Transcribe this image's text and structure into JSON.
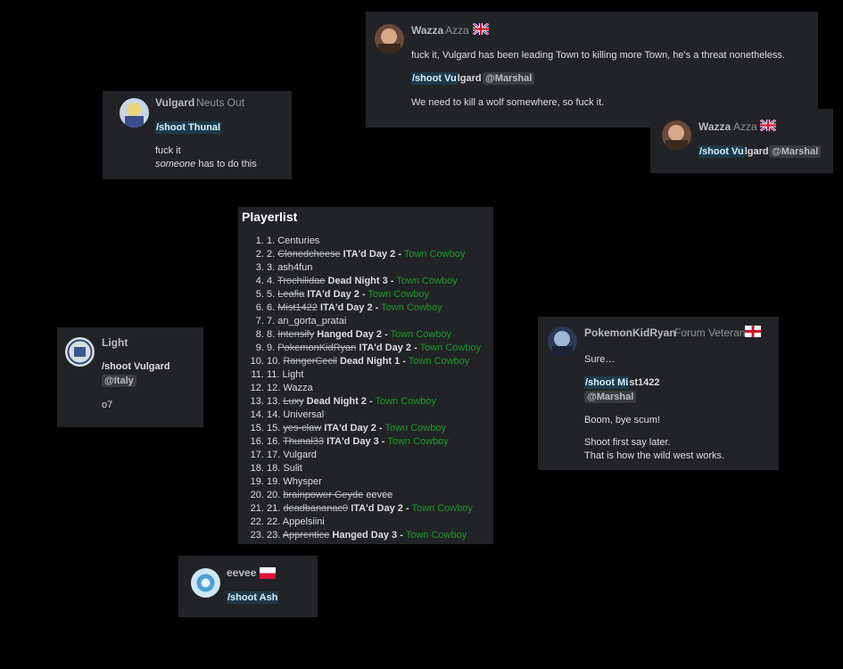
{
  "posts": {
    "wazza1": {
      "username": "Wazza",
      "title": "Azza",
      "line1": "fuck it, Vulgard has been leading Town to killing more Town, he's a threat nonetheless.",
      "cmd_hl": "/shoot Vu",
      "cmd_rest": "lgard",
      "mention": "@Marshal",
      "line3": "We need to kill a wolf somewhere, so fuck it."
    },
    "wazza2": {
      "username": "Wazza",
      "title": "Azza",
      "cmd_hl": "/shoot Vu",
      "cmd_rest": "lgard",
      "mention": "@Marshal"
    },
    "vulgard": {
      "username": "Vulgard",
      "title": "Neuts Out",
      "cmd": "/shoot Thunal",
      "line1": "fuck it",
      "line2_em": "someone",
      "line2_rest": " has to do this"
    },
    "light": {
      "username": "Light",
      "cmd": "/shoot Vulgard",
      "mention": "@Italy",
      "line1": "o7"
    },
    "pkr": {
      "username": "PokemonKidRyan",
      "title": "Forum Veteran",
      "line1": "Sure…",
      "cmd_hl": "/shoot Mi",
      "cmd_rest": "st1422",
      "mention": "@Marshal",
      "line3": "Boom, bye scum!",
      "line4": "Shoot first say later.",
      "line5": "That is how the wild west works."
    },
    "eevee": {
      "username": "eevee",
      "cmd": "/shoot Ash"
    }
  },
  "playerlist": {
    "title": "Playerlist",
    "players": [
      {
        "struck": "",
        "name": "Centuries",
        "status": "",
        "role": ""
      },
      {
        "struck": "Clonedcheese",
        "name": "",
        "status": "ITA'd Day 2 -",
        "role": "Town Cowboy"
      },
      {
        "struck": "",
        "name": "ash4fun",
        "status": "",
        "role": ""
      },
      {
        "struck": "Trochilidae",
        "name": "",
        "status": "Dead Night 3 -",
        "role": "Town Cowboy"
      },
      {
        "struck": "Leafia",
        "name": "",
        "status": "ITA'd Day 2 -",
        "role": "Town Cowboy"
      },
      {
        "struck": "Mist1422",
        "name": "",
        "status": "ITA'd Day 2 -",
        "role": "Town Cowboy"
      },
      {
        "struck": "",
        "name": "an_gorta_pratai",
        "status": "",
        "role": ""
      },
      {
        "struck": "Intensify",
        "name": "",
        "status": "Hanged Day 2 -",
        "role": "Town Cowboy"
      },
      {
        "struck": "PokemonKidRyan",
        "name": "",
        "status": "ITA'd Day 2 -",
        "role": "Town Cowboy"
      },
      {
        "struck": "RangerCecil",
        "name": "",
        "status": "Dead Night 1 -",
        "role": "Town Cowboy"
      },
      {
        "struck": "",
        "name": "Light",
        "status": "",
        "role": ""
      },
      {
        "struck": "",
        "name": "Wazza",
        "status": "",
        "role": ""
      },
      {
        "struck": "Luxy",
        "name": "",
        "status": "Dead Night 2 -",
        "role": "Town Cowboy"
      },
      {
        "struck": "",
        "name": "Universal",
        "status": "",
        "role": ""
      },
      {
        "struck": "yes-claw",
        "name": "",
        "status": "ITA'd Day 2 -",
        "role": "Town Cowboy"
      },
      {
        "struck": "Thunal33",
        "name": "",
        "status": "ITA'd Day 3 -",
        "role": "Town Cowboy"
      },
      {
        "struck": "",
        "name": "Vulgard",
        "status": "",
        "role": ""
      },
      {
        "struck": "",
        "name": "Sulit",
        "status": "",
        "role": ""
      },
      {
        "struck": "",
        "name": "Whysper",
        "status": "",
        "role": ""
      },
      {
        "struck": "brainpower Geyde",
        "name": "eevee",
        "status": "",
        "role": ""
      },
      {
        "struck": "deadbananac0",
        "name": "",
        "status": "ITA'd Day 2 -",
        "role": "Town Cowboy"
      },
      {
        "struck": "",
        "name": "Appelsiini",
        "status": "",
        "role": ""
      },
      {
        "struck": "Apprentice",
        "name": "",
        "status": "Hanged Day 3 -",
        "role": "Town Cowboy"
      }
    ]
  },
  "colors": {
    "background": "#000000",
    "card": "#222326",
    "role_green": "#1a9a2a",
    "command_highlight": "#1e3a4b"
  },
  "icons": {
    "uk_flag": "uk-flag-icon",
    "england_flag": "england-flag-icon",
    "poland_flag": "poland-flag-icon"
  }
}
